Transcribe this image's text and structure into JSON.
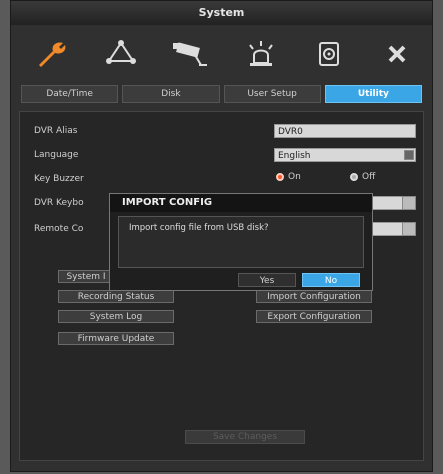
{
  "window": {
    "title": "System"
  },
  "toolbar": {
    "icons": [
      {
        "name": "wrench-icon"
      },
      {
        "name": "network-icon"
      },
      {
        "name": "camera-icon"
      },
      {
        "name": "alarm-light-icon"
      },
      {
        "name": "hdd-icon"
      },
      {
        "name": "close-icon"
      }
    ]
  },
  "tabs": [
    {
      "label": "Date/Time",
      "active": false
    },
    {
      "label": "Disk",
      "active": false
    },
    {
      "label": "User Setup",
      "active": false
    },
    {
      "label": "Utility",
      "active": true
    }
  ],
  "utility": {
    "dvr_alias_label": "DVR Alias",
    "dvr_alias_value": "DVR0",
    "language_label": "Language",
    "language_value": "English",
    "key_buzzer_label": "Key Buzzer",
    "key_buzzer_on": "On",
    "key_buzzer_off": "Off",
    "dvr_keyboard_label": "DVR Keybo",
    "remote_control_label": "Remote Co",
    "buttons": {
      "system_info": "System I",
      "recording_status": "Recording Status",
      "system_log": "System Log",
      "firmware_update": "Firmware Update",
      "import_configuration": "Import Configuration",
      "export_configuration": "Export Configuration",
      "save_changes": "Save Changes"
    }
  },
  "dialog": {
    "title": "IMPORT CONFIG",
    "message": "Import config file from USB disk?",
    "yes_label": "Yes",
    "no_label": "No"
  },
  "colors": {
    "accent": "#3aa6e6",
    "icon_orange": "#f28a2a",
    "radio_on": "#ff5a2a"
  }
}
